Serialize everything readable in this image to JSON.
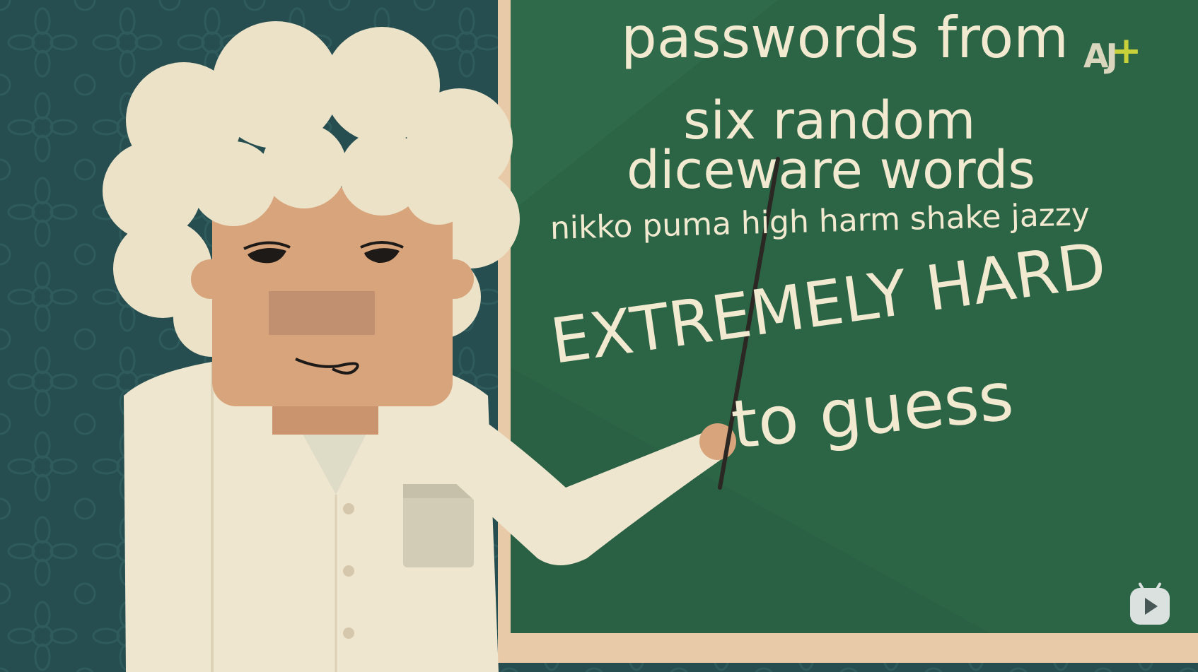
{
  "board": {
    "line1": "passwords from",
    "line2": "six random",
    "line3": "diceware words",
    "line4": "nikko puma high harm shake jazzy",
    "line5": "EXTREMELY HARD",
    "line6": "to guess"
  },
  "logo": {
    "text": "AJ",
    "plus": "+"
  },
  "colors": {
    "wall": "#264e50",
    "board": "#2f6b4a",
    "frame": "#e8c9a8",
    "chalk": "#f2ead0",
    "skin": "#d8a47c",
    "hair": "#ece2c8",
    "coat": "#efe6cf",
    "logo_plus": "#c9d13a"
  },
  "icons": {
    "play_badge": "tv-play-icon"
  }
}
